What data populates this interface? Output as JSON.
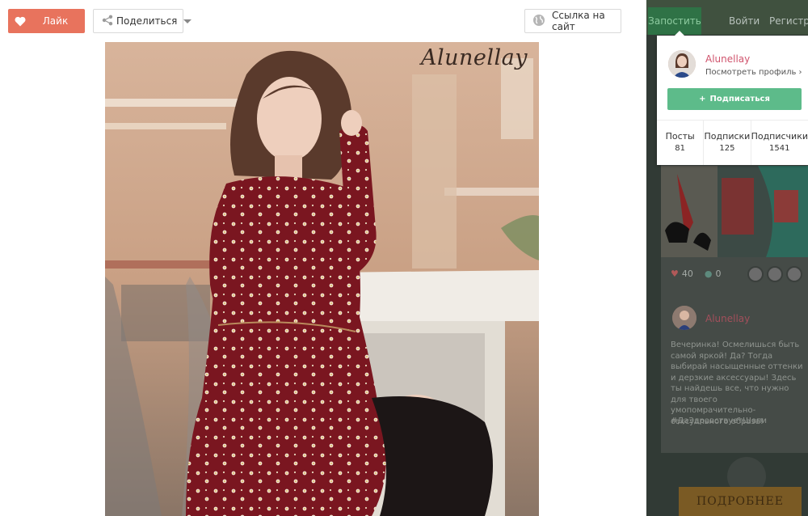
{
  "toolbar": {
    "like_label": "Лайк",
    "share_label": "Поделиться",
    "link_label": "Ссылка на сайт"
  },
  "photo": {
    "watermark": "Alunellay"
  },
  "topnav": {
    "post_label": "Запостить",
    "login_label": "Войти",
    "register_label": "Регистрация"
  },
  "profile_popup": {
    "name": "Alunellay",
    "view_profile": "Посмотреть профиль ›",
    "subscribe_label": "Подписаться",
    "stats": [
      {
        "label": "Посты",
        "value": "81"
      },
      {
        "label": "Подписки",
        "value": "125"
      },
      {
        "label": "Подписчики",
        "value": "1541"
      }
    ]
  },
  "feed_card": {
    "likes": "40",
    "comments": "0",
    "author": "Alunellay",
    "text": "Вечеринка! Осмелишься быть самой яркой! Да? Тогда выбирай насыщенные оттенки и дерзкие аксессуары! Здесь ты найдешь все, что нужно для твоего умопомрачительно-сексуального образа!",
    "tag": "#ДаЗдравствуетШопи",
    "more_label": "ПОДРОБНЕЕ"
  },
  "colors": {
    "like_button": "#e8735d",
    "subscribe_button": "#5dbb8a",
    "profile_name": "#d0546d",
    "dress": "#7a1620"
  }
}
